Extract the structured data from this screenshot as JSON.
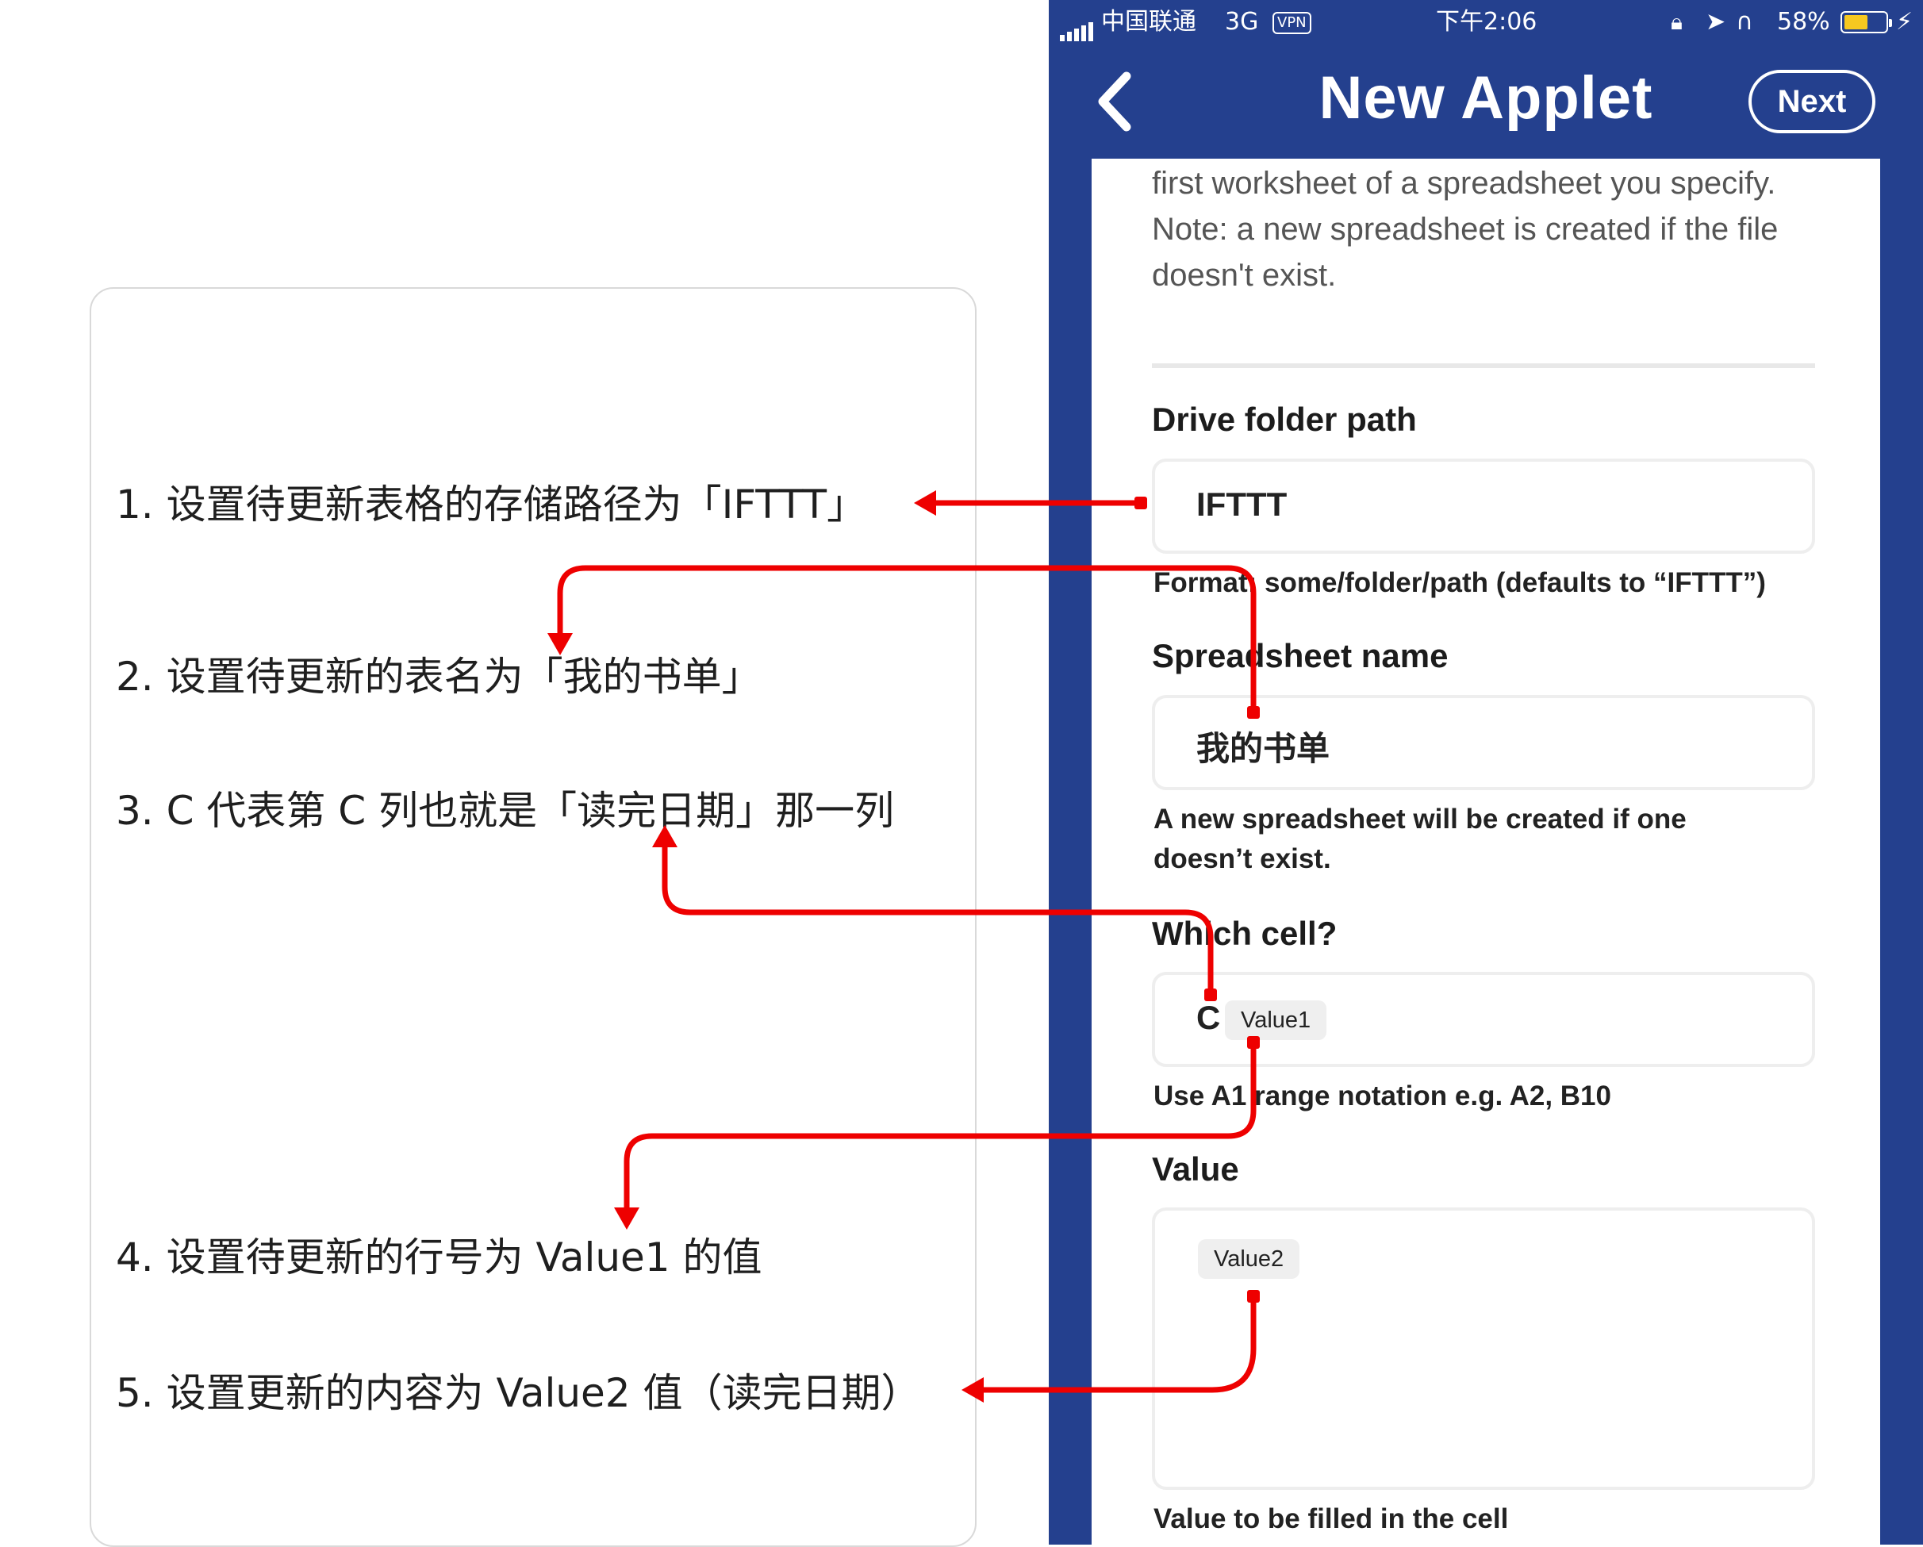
{
  "notes": [
    "1. 设置待更新表格的存储路径为「IFTTT」",
    "2. 设置待更新的表名为「我的书单」",
    "3. C 代表第 C 列也就是「读完日期」那一列",
    "4. 设置待更新的行号为 Value1 的值",
    "5. 设置更新的内容为 Value2 值（读完日期）"
  ],
  "status_bar": {
    "carrier": "中国联通",
    "network": "3G",
    "vpn": "VPN",
    "time": "下午2:06",
    "battery": "58%",
    "battery_level": 0.58
  },
  "nav": {
    "title": "New Applet",
    "next_label": "Next",
    "back_icon": "chevron-left-icon"
  },
  "form": {
    "description": "first worksheet of a spreadsheet you specify. Note: a new spreadsheet is created if the file doesn't exist.",
    "drive_folder": {
      "label": "Drive folder path",
      "value": "IFTTT",
      "help": "Format: some/folder/path (defaults to “IFTTT”)"
    },
    "spreadsheet": {
      "label": "Spreadsheet name",
      "value": "我的书单",
      "help_line1": "A new spreadsheet will be created if one",
      "help_line2": "doesn’t exist."
    },
    "cell": {
      "label": "Which cell?",
      "value": "C",
      "ingredient": "Value1",
      "help": "Use A1 range notation e.g. A2, B10"
    },
    "value": {
      "label": "Value",
      "ingredient": "Value2",
      "help": "Value to be filled in the cell"
    }
  },
  "colors": {
    "brand_blue": "#24408e",
    "arrow_red": "#ee0000",
    "battery_yellow": "#f6c820"
  }
}
